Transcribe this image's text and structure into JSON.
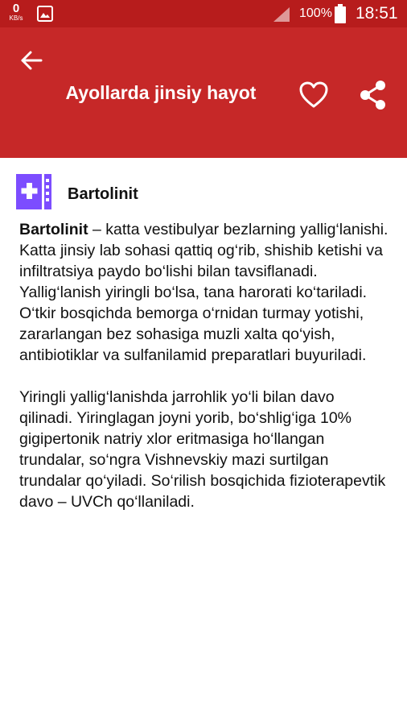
{
  "status_bar": {
    "net_speed": "0",
    "net_unit": "KB/s",
    "battery": "100%",
    "time": "18:51"
  },
  "app_bar": {
    "title": "Ayollarda jinsiy hayot",
    "back_icon": "arrow-back-icon",
    "favorite_icon": "heart-outline-icon",
    "share_icon": "share-icon",
    "color": "#c62828"
  },
  "article": {
    "icon": "medical-book-icon",
    "icon_color": "#7c4dff",
    "heading": "Bartolinit",
    "p1_term": "Bartolinit",
    "p1_rest": " – katta vestibulyar bezlarning yallig‘lanishi. Katta jinsiy lab sohasi qattiq og‘rib, shishib ketishi va infiltratsiya paydo bo‘lishi bilan tavsiflanadi. Yallig‘lanish yiringli bo‘lsa, tana harorati ko‘tariladi. O‘tkir bosqichda bemorga o‘rnidan turmay yotishi, zararlangan bez sohasiga muzli xalta qo‘yish, antibiotiklar va sulfanilamid preparatlari buyuriladi.",
    "p2": "Yiringli yallig‘lanishda jarrohlik yo‘li bilan davo qilinadi. Yiringlagan joyni yorib, bo‘shlig‘iga 10% gigipertonik natriy xlor eritmasiga ho‘llangan trundalar, so‘ngra Vishnevskiy mazi surtilgan trundalar qo‘yiladi. So‘rilish bosqichida fizioterapevtik davo – UVCh qo‘llaniladi."
  }
}
